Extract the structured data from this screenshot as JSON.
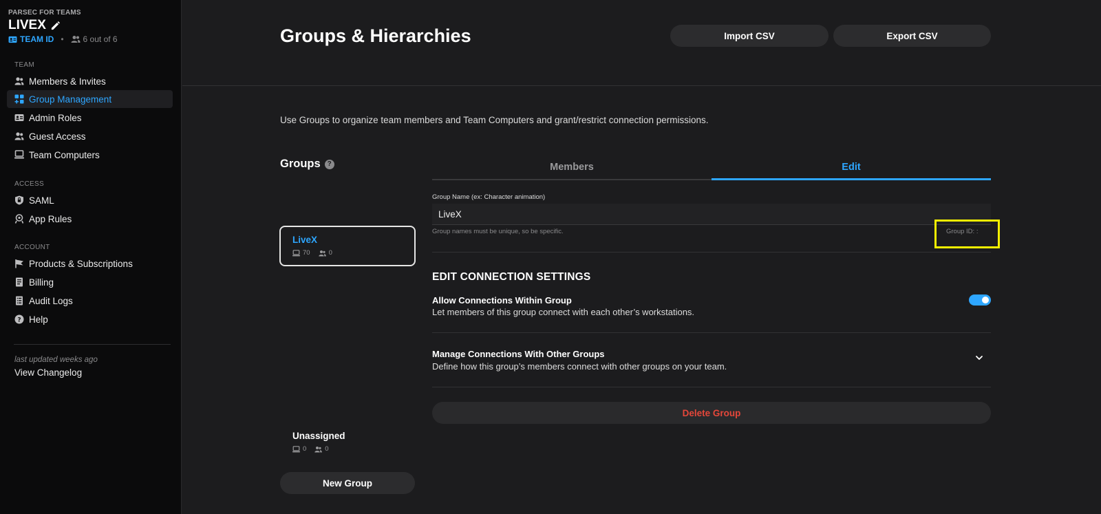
{
  "sidebar": {
    "brand": "PARSEC FOR TEAMS",
    "team_name": "LIVEX",
    "team_id_label": "TEAM ID",
    "separator": "•",
    "seats": "6 out of 6",
    "sections": {
      "team": "TEAM",
      "access": "ACCESS",
      "account": "ACCOUNT"
    },
    "items": [
      {
        "label": "Members & Invites",
        "icon": "members-icon"
      },
      {
        "label": "Group Management",
        "icon": "group-management-icon",
        "active": true
      },
      {
        "label": "Admin Roles",
        "icon": "admin-roles-icon"
      },
      {
        "label": "Guest Access",
        "icon": "guest-access-icon"
      },
      {
        "label": "Team Computers",
        "icon": "computer-icon"
      },
      {
        "label": "SAML",
        "icon": "saml-icon"
      },
      {
        "label": "App Rules",
        "icon": "app-rules-icon"
      },
      {
        "label": "Products & Subscriptions",
        "icon": "flag-icon"
      },
      {
        "label": "Billing",
        "icon": "billing-icon"
      },
      {
        "label": "Audit Logs",
        "icon": "audit-logs-icon"
      },
      {
        "label": "Help",
        "icon": "help-icon"
      }
    ],
    "last_updated": "last updated weeks ago",
    "changelog": "View Changelog"
  },
  "header": {
    "title": "Groups & Hierarchies",
    "import_label": "Import CSV",
    "export_label": "Export CSV"
  },
  "main": {
    "description": "Use Groups to organize team members and Team Computers and grant/restrict connection permissions.",
    "groups_heading": "Groups",
    "help_glyph": "?",
    "groups": [
      {
        "name": "LiveX",
        "computers": "70",
        "members": "0",
        "selected": true
      },
      {
        "name": "Unassigned",
        "computers": "0",
        "members": "0"
      }
    ],
    "new_group_label": "New Group",
    "tabs": [
      {
        "label": "Members"
      },
      {
        "label": "Edit",
        "active": true
      }
    ],
    "edit": {
      "field_label": "Group Name (ex: Character animation)",
      "name_value": "LiveX",
      "hint": "Group names must be unique, so be specific.",
      "group_id_label": "Group ID: :",
      "settings_title": "EDIT CONNECTION SETTINGS",
      "allow_title": "Allow Connections Within Group",
      "allow_desc": "Let members of this group connect with each other’s workstations.",
      "allow_enabled": true,
      "manage_title": "Manage Connections With Other Groups",
      "manage_desc": "Define how this group’s members connect with other groups on your team.",
      "delete_label": "Delete Group"
    }
  },
  "colors": {
    "accent": "#2ea6ff",
    "danger": "#e5473a",
    "highlight": "#f5f100",
    "background": "#1c1c1e",
    "sidebar": "#0b0b0c"
  }
}
